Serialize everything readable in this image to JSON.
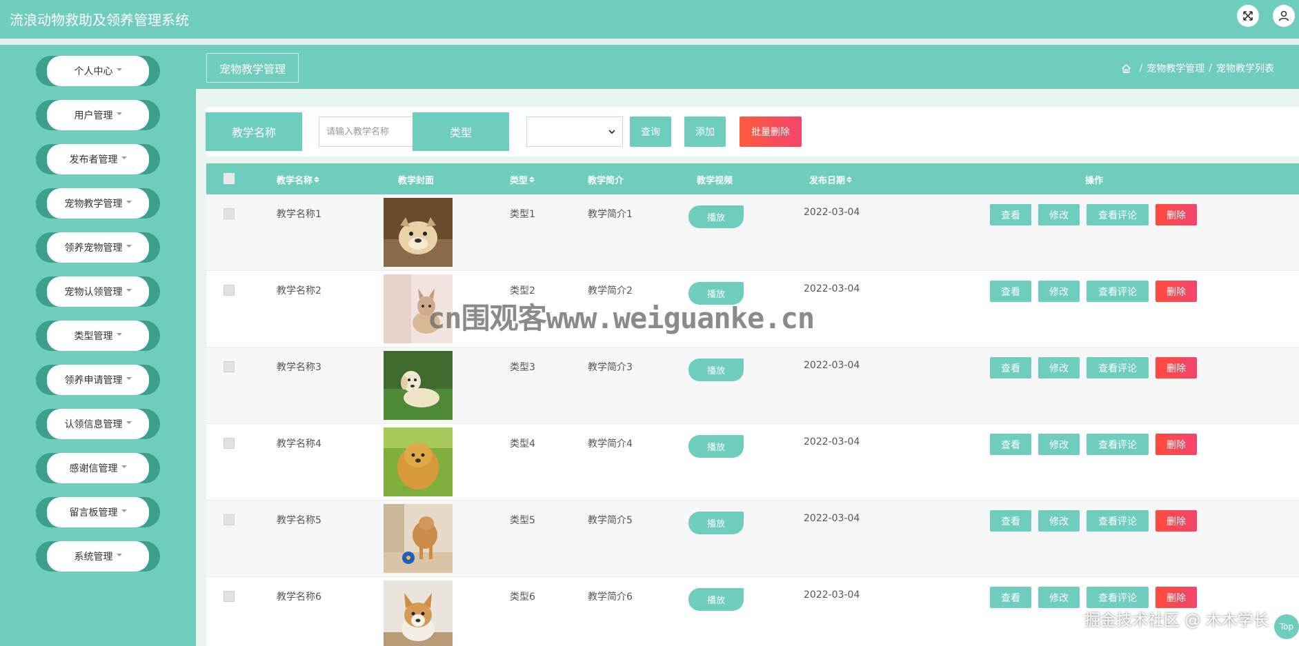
{
  "app": {
    "title": "流浪动物救助及领养管理系统"
  },
  "sidebar": {
    "items": [
      {
        "label": "个人中心"
      },
      {
        "label": "用户管理"
      },
      {
        "label": "发布者管理"
      },
      {
        "label": "宠物教学管理"
      },
      {
        "label": "领养宠物管理"
      },
      {
        "label": "宠物认领管理"
      },
      {
        "label": "类型管理"
      },
      {
        "label": "领养申请管理"
      },
      {
        "label": "认领信息管理"
      },
      {
        "label": "感谢信管理"
      },
      {
        "label": "留言板管理"
      },
      {
        "label": "系统管理"
      }
    ]
  },
  "page": {
    "tag": "宠物教学管理",
    "breadcrumb": [
      "宠物教学管理",
      "宠物教学列表"
    ]
  },
  "search": {
    "name_label": "教学名称",
    "name_placeholder": "请输入教学名称",
    "type_label": "类型",
    "type_selected": "",
    "query_button": "查询",
    "add_button": "添加",
    "batch_delete_button": "批量删除"
  },
  "table": {
    "headers": {
      "name": "教学名称",
      "cover": "教学封面",
      "type": "类型",
      "intro": "教学简介",
      "video": "教学视频",
      "date": "发布日期",
      "actions": "操作"
    },
    "play_label": "播放",
    "action_labels": {
      "view": "查看",
      "edit": "修改",
      "comments": "查看评论",
      "delete": "删除"
    },
    "rows": [
      {
        "name": "教学名称1",
        "type": "类型1",
        "intro": "教学简介1",
        "date": "2022-03-04"
      },
      {
        "name": "教学名称2",
        "type": "类型2",
        "intro": "教学简介2",
        "date": "2022-03-04"
      },
      {
        "name": "教学名称3",
        "type": "类型3",
        "intro": "教学简介3",
        "date": "2022-03-04"
      },
      {
        "name": "教学名称4",
        "type": "类型4",
        "intro": "教学简介4",
        "date": "2022-03-04"
      },
      {
        "name": "教学名称5",
        "type": "类型5",
        "intro": "教学简介5",
        "date": "2022-03-04"
      },
      {
        "name": "教学名称6",
        "type": "类型6",
        "intro": "教学简介6",
        "date": "2022-03-04"
      }
    ]
  },
  "overlay": {
    "watermark": "cn围观客www.weiguanke.cn",
    "credit": "掘金技术社区 @ 木木学长",
    "top_button": "Top"
  },
  "colors": {
    "primary": "#6fcdbe",
    "sidebar_ring": "#3a9f8b",
    "danger": "#f2456d"
  }
}
